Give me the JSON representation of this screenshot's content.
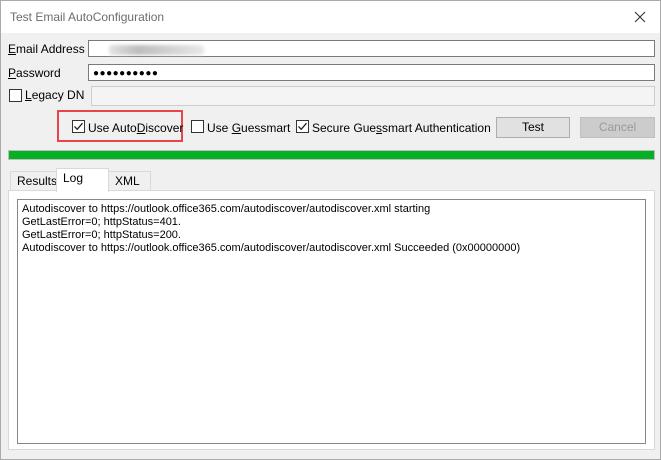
{
  "window": {
    "title": "Test Email AutoConfiguration"
  },
  "form": {
    "email_label_prefix": "E",
    "email_label_rest": "mail Address",
    "password_label_prefix": "P",
    "password_label_rest": "assword",
    "password_value": "●●●●●●●●●●",
    "legacy_dn_label_prefix": "L",
    "legacy_dn_label_rest": "egacy DN",
    "legacy_dn_checked": false
  },
  "options": {
    "use_autodiscover_prefix": "Use Auto",
    "use_autodiscover_ul": "D",
    "use_autodiscover_rest": "iscover",
    "use_autodiscover_checked": true,
    "use_guessmart_prefix": "Use ",
    "use_guessmart_ul": "G",
    "use_guessmart_rest": "uessmart",
    "use_guessmart_checked": false,
    "secure_guessmart_prefix": "Secure Gue",
    "secure_guessmart_ul": "s",
    "secure_guessmart_rest": "smart Authentication",
    "secure_guessmart_checked": true
  },
  "buttons": {
    "test_label": "Test",
    "cancel_label": "Cancel"
  },
  "progress": {
    "percent": 100,
    "color": "#06b025"
  },
  "tabs": [
    {
      "label": "Results",
      "active": false
    },
    {
      "label": "Log",
      "active": true
    },
    {
      "label": "XML",
      "active": false
    }
  ],
  "log": {
    "lines": [
      "Autodiscover to https://outlook.office365.com/autodiscover/autodiscover.xml starting",
      "GetLastError=0; httpStatus=401.",
      "GetLastError=0; httpStatus=200.",
      "Autodiscover to https://outlook.office365.com/autodiscover/autodiscover.xml Succeeded (0x00000000)"
    ]
  },
  "icons": {
    "close": "close-icon",
    "checkmark": "checkmark-icon"
  },
  "colors": {
    "highlight": "#e8454b",
    "progress": "#06b025"
  }
}
